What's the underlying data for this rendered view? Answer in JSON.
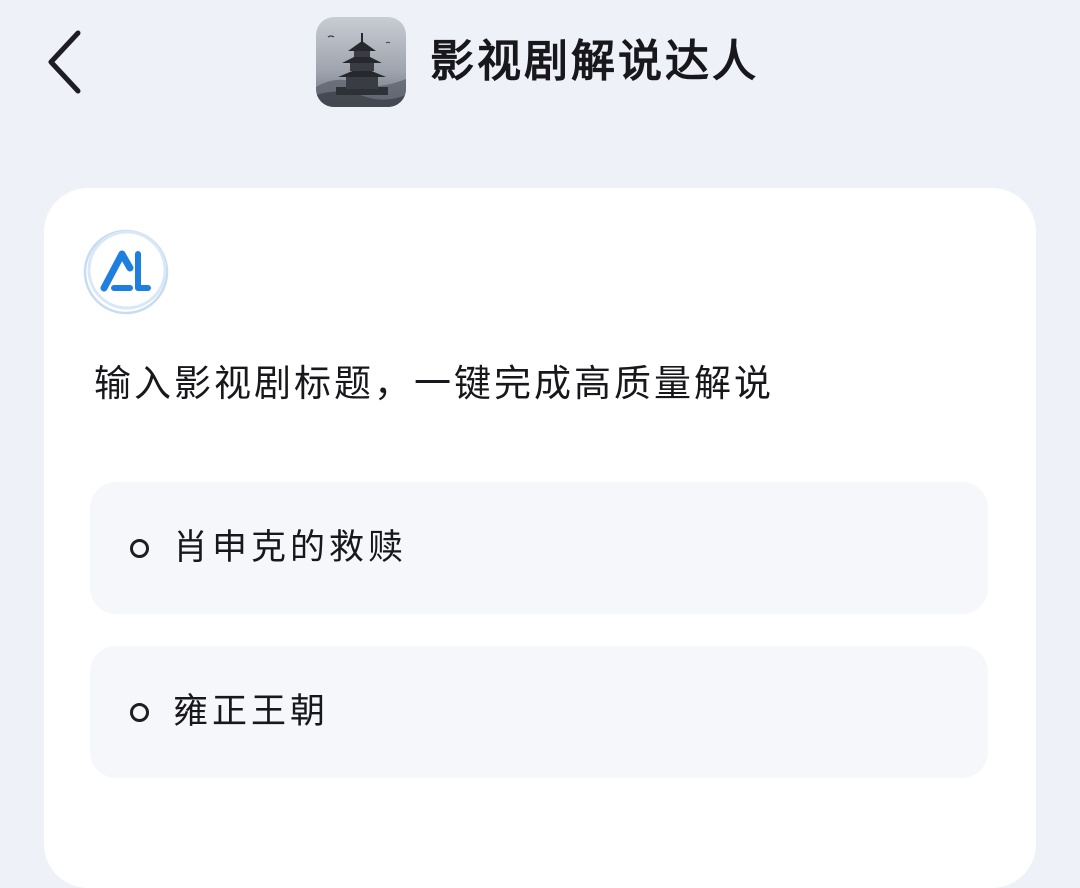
{
  "header": {
    "back_icon": "chevron-left-icon",
    "avatar_icon": "pavilion-tower-avatar",
    "bot_name": "影视剧解说达人"
  },
  "card": {
    "logo_icon": "ai-logo-icon",
    "logo_colors": {
      "ring": "#bcd6f0",
      "mark": "#1f7fe0"
    },
    "intro": "输入影视剧标题，一键完成高质量解说",
    "suggestions": [
      {
        "label": "肖申克的救赎"
      },
      {
        "label": "雍正王朝"
      }
    ]
  }
}
